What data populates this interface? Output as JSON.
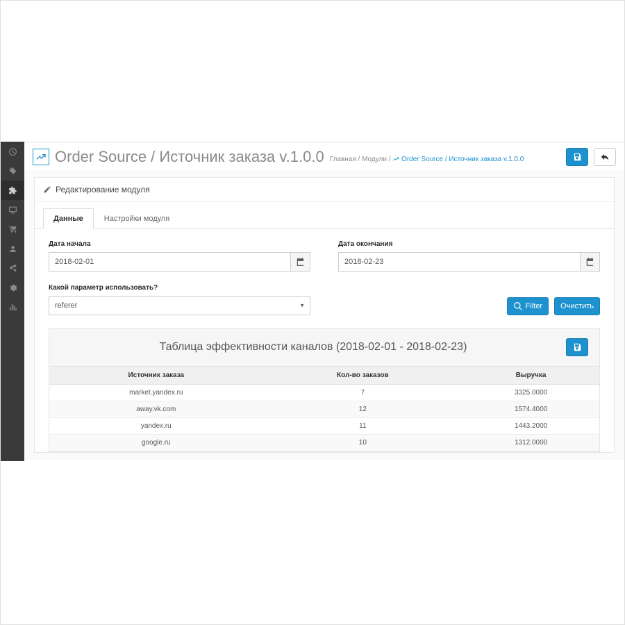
{
  "page_title": "Order Source / Источник заказа v.1.0.0",
  "breadcrumb": {
    "home": "Главная",
    "modules": "Модули",
    "current": "Order Source / Источник заказа v.1.0.0"
  },
  "panel_heading": "Редактирование модуля",
  "tabs": [
    {
      "label": "Данные",
      "active": true
    },
    {
      "label": "Настройки модуля",
      "active": false
    }
  ],
  "form": {
    "date_start_label": "Дата начала",
    "date_start_value": "2018-02-01",
    "date_end_label": "Дата окончания",
    "date_end_value": "2018-02-23",
    "param_label": "Какой параметр использовать?",
    "param_options": [
      "referer"
    ],
    "param_value": "referer",
    "filter_button": "Filter",
    "clear_button": "Очистить"
  },
  "results": {
    "title": "Таблица эффективности каналов (2018-02-01 - 2018-02-23)",
    "columns": {
      "source": "Источник заказа",
      "orders": "Кол-во заказов",
      "revenue": "Выручка"
    },
    "rows": [
      {
        "source": "market.yandex.ru",
        "orders": 7,
        "revenue": "3325.0000"
      },
      {
        "source": "away.vk.com",
        "orders": 12,
        "revenue": "1574.4000"
      },
      {
        "source": "yandex.ru",
        "orders": 11,
        "revenue": "1443.2000"
      },
      {
        "source": "google.ru",
        "orders": 10,
        "revenue": "1312.0000"
      }
    ]
  },
  "chart_data": {
    "type": "table",
    "title": "Таблица эффективности каналов (2018-02-01 - 2018-02-23)",
    "columns": [
      "Источник заказа",
      "Кол-во заказов",
      "Выручка"
    ],
    "rows": [
      [
        "market.yandex.ru",
        7,
        3325.0
      ],
      [
        "away.vk.com",
        12,
        1574.4
      ],
      [
        "yandex.ru",
        11,
        1443.2
      ],
      [
        "google.ru",
        10,
        1312.0
      ]
    ]
  },
  "colors": {
    "primary": "#1e91cf"
  }
}
